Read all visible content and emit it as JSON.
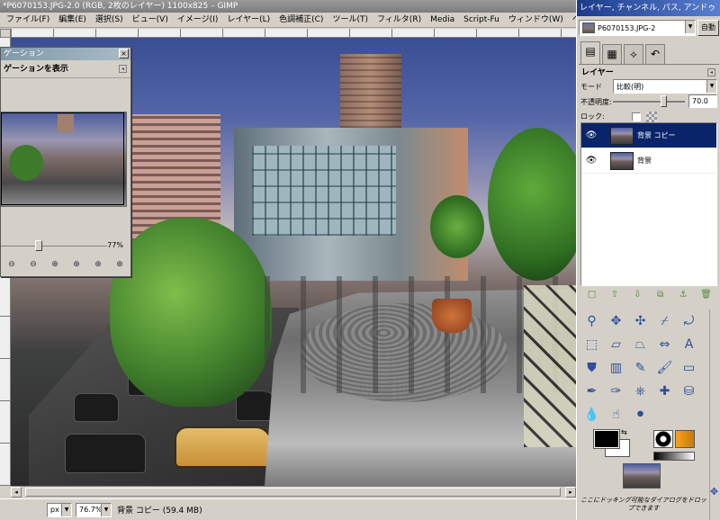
{
  "window": {
    "title": "*P6070153.JPG-2.0 (RGB, 2枚のレイヤー) 1100x825 – GIMP"
  },
  "menubar": {
    "items": [
      "ファイル(F)",
      "編集(E)",
      "選択(S)",
      "ビュー(V)",
      "イメージ(I)",
      "レイヤー(L)",
      "色調補正(C)",
      "ツール(T)",
      "フィルタ(R)",
      "Media",
      "Script-Fu",
      "ウィンドウ(W)",
      "ヘルプ(H)"
    ]
  },
  "navigation": {
    "title": "ゲーション",
    "heading": "ゲーションを表示",
    "zoom_value": "77%",
    "zoom_level": 0.36,
    "close_glyph": "×",
    "tab_menu_glyph": "◂",
    "buttons": [
      "⊖",
      "⊖",
      "⊕",
      "⊕",
      "⊕",
      "⊕"
    ]
  },
  "statusbar": {
    "unit": "px",
    "zoom": "76.7%",
    "text": "背景 コピー (59.4 MB)"
  },
  "dock": {
    "title": "レイヤー, チャンネル, パス, アンドゥ",
    "image_select": "P6070153.JPG-2",
    "auto_button": "自動",
    "tab_icons": [
      "layers-icon",
      "channels-icon",
      "paths-icon",
      "undo-icon"
    ],
    "tab_glyphs": [
      "▤",
      "▦",
      "⟡",
      "↶"
    ],
    "layers_heading": "レイヤー",
    "mode_label": "モード",
    "mode_value": "比較(明)",
    "opacity_label": "不透明度:",
    "opacity_value": "70.0",
    "opacity_fraction": 0.7,
    "lock_label": "ロック:",
    "layers": [
      {
        "name": "背景 コピー",
        "selected": true
      },
      {
        "name": "背景",
        "selected": false
      }
    ],
    "eye_glyph": "👁",
    "layer_buttons": [
      "□",
      "⇧",
      "⇩",
      "⧉",
      "⚓",
      "🗑"
    ],
    "layer_button_icons": [
      "new-layer-icon",
      "raise-layer-icon",
      "lower-layer-icon",
      "duplicate-layer-icon",
      "anchor-layer-icon",
      "delete-layer-icon"
    ],
    "hint": "ここにドッキング可能なダイアログをドロップできます"
  },
  "toolbox": {
    "tools": [
      {
        "icon": "fuzzy-select-icon",
        "glyph": "⚲"
      },
      {
        "icon": "move-icon",
        "glyph": "✥"
      },
      {
        "icon": "align-icon",
        "glyph": "✣"
      },
      {
        "icon": "crop-icon",
        "glyph": "⌿"
      },
      {
        "icon": "rotate-icon",
        "glyph": "⤾"
      },
      {
        "icon": "scale-icon",
        "glyph": "⬚"
      },
      {
        "icon": "shear-icon",
        "glyph": "▱"
      },
      {
        "icon": "perspective-icon",
        "glyph": "⏢"
      },
      {
        "icon": "flip-icon",
        "glyph": "⇔"
      },
      {
        "icon": "text-icon",
        "glyph": "A"
      },
      {
        "icon": "bucket-fill-icon",
        "glyph": "⛊"
      },
      {
        "icon": "blend-icon",
        "glyph": "▥"
      },
      {
        "icon": "pencil-icon",
        "glyph": "✎"
      },
      {
        "icon": "paintbrush-icon",
        "glyph": "🖌"
      },
      {
        "icon": "eraser-icon",
        "glyph": "▭"
      },
      {
        "icon": "airbrush-icon",
        "glyph": "✒"
      },
      {
        "icon": "ink-icon",
        "glyph": "✑"
      },
      {
        "icon": "clone-icon",
        "glyph": "⎈"
      },
      {
        "icon": "heal-icon",
        "glyph": "✚"
      },
      {
        "icon": "perspective-clone-icon",
        "glyph": "⛁"
      },
      {
        "icon": "blur-icon",
        "glyph": "💧"
      },
      {
        "icon": "smudge-icon",
        "glyph": "☝"
      },
      {
        "icon": "dodge-burn-icon",
        "glyph": "⚫"
      }
    ],
    "swap_glyph": "⇆"
  },
  "colors": {
    "accent_dock_title": "#1c3a8a",
    "selection": "#0a246a",
    "foreground": "#000000",
    "background": "#ffffff"
  }
}
